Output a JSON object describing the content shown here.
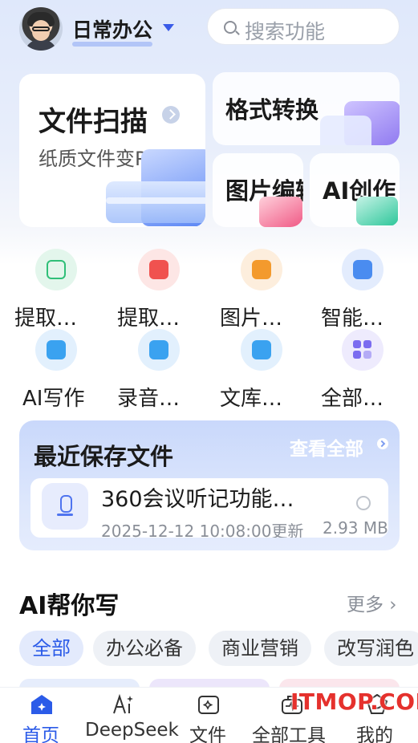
{
  "header": {
    "workspace_name": "日常办公",
    "search_placeholder": "搜索功能"
  },
  "feature_cards": {
    "scan": {
      "title": "文件扫描",
      "subtitle": "纸质文件变PDF"
    },
    "convert": {
      "title": "格式转换"
    },
    "image_edit": {
      "title": "图片编辑"
    },
    "ai_create": {
      "title": "AI创作"
    }
  },
  "tools": [
    {
      "label": "提取…",
      "icon": "text-extract-icon",
      "color": "#2fbf78"
    },
    {
      "label": "提取…",
      "icon": "table-extract-icon",
      "color": "#f0524f"
    },
    {
      "label": "图片…",
      "icon": "image-pdf-icon",
      "color": "#f39a2d"
    },
    {
      "label": "智能…",
      "icon": "ai-image-icon",
      "color": "#4a8cf0"
    },
    {
      "label": "AI写作",
      "icon": "ai-write-icon",
      "color": "#3aa2f0"
    },
    {
      "label": "录音…",
      "icon": "mic-icon",
      "color": "#3aa2f0"
    },
    {
      "label": "文库…",
      "icon": "library-icon",
      "color": "#3aa2f0"
    },
    {
      "label": "全部…",
      "icon": "grid-icon",
      "color": "#7b6cf0"
    }
  ],
  "recent": {
    "title": "最近保存文件",
    "view_all": "查看全部",
    "file": {
      "name": "360会议听记功能…",
      "meta": "2025-12-12 10:08:00更新",
      "size": "2.93 MB"
    }
  },
  "ai_write": {
    "title": "AI帮你写",
    "more": "更多",
    "chips": [
      "全部",
      "办公必备",
      "商业营销",
      "改写润色"
    ]
  },
  "tabbar": [
    {
      "label": "首页",
      "icon": "home-icon",
      "active": true
    },
    {
      "label": "DeepSeek",
      "icon": "ai-sparkle-icon",
      "active": false
    },
    {
      "label": "文件",
      "icon": "folder-icon",
      "active": false
    },
    {
      "label": "全部工具",
      "icon": "toolbox-icon",
      "active": false
    },
    {
      "label": "我的",
      "icon": "profile-icon",
      "active": false
    }
  ],
  "watermark": "ITMOP.COM",
  "colors": {
    "accent": "#2b5be8",
    "active_chip_bg": "#e3eafc"
  }
}
